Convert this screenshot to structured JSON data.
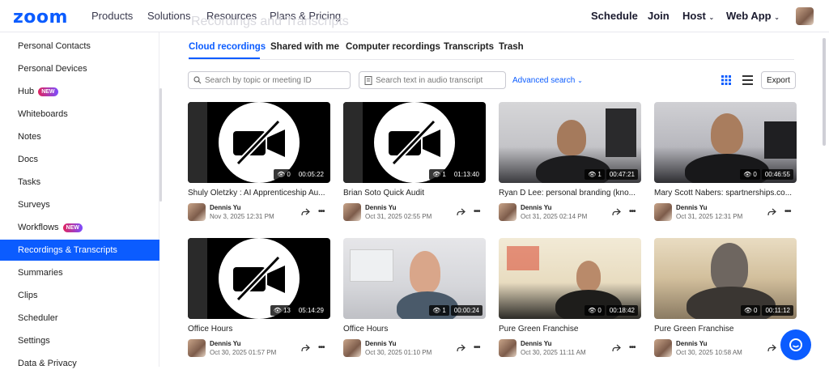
{
  "nav": {
    "logo": "zoom",
    "left_links": [
      "Products",
      "Solutions",
      "Resources",
      "Plans & Pricing"
    ],
    "right_links": [
      "Schedule",
      "Join",
      "Host",
      "Web App"
    ]
  },
  "sidebar": {
    "items": [
      {
        "label": "Personal Contacts"
      },
      {
        "label": "Personal Devices"
      },
      {
        "label": "Hub",
        "badge": "NEW"
      },
      {
        "label": "Whiteboards"
      },
      {
        "label": "Notes"
      },
      {
        "label": "Docs"
      },
      {
        "label": "Tasks"
      },
      {
        "label": "Surveys"
      },
      {
        "label": "Workflows",
        "badge": "NEW"
      },
      {
        "label": "Recordings & Transcripts",
        "active": true
      },
      {
        "label": "Summaries"
      },
      {
        "label": "Clips"
      },
      {
        "label": "Scheduler"
      },
      {
        "label": "Settings"
      },
      {
        "label": "Data & Privacy"
      }
    ]
  },
  "main": {
    "ghost_title": "Recordings and Transcripts",
    "tabs": [
      "Cloud recordings",
      "Shared with me",
      "Computer recordings",
      "Transcripts",
      "Trash"
    ],
    "search_placeholder": "Search by topic or meeting ID",
    "transcript_placeholder": "Search text in audio transcript",
    "advanced_search": "Advanced search",
    "export_label": "Export",
    "recordings": [
      {
        "title": "Shuly Oletzky : AI Apprenticeship Au...",
        "owner": "Dennis Yu",
        "date": "Nov 3, 2025 12:31 PM",
        "views": "0",
        "duration": "00:05:22",
        "type": "novideo"
      },
      {
        "title": "Brian Soto Quick Audit",
        "owner": "Dennis Yu",
        "date": "Oct 31, 2025 02:55 PM",
        "views": "1",
        "duration": "01:13:40",
        "type": "novideo"
      },
      {
        "title": "Ryan D Lee: personal branding (kno...",
        "owner": "Dennis Yu",
        "date": "Oct 31, 2025 02:14 PM",
        "views": "1",
        "duration": "00:47:21",
        "type": "camera"
      },
      {
        "title": "Mary Scott Nabers: spartnerships.co...",
        "owner": "Dennis Yu",
        "date": "Oct 31, 2025 12:31 PM",
        "views": "0",
        "duration": "00:46:55",
        "type": "camera"
      },
      {
        "title": "Office Hours",
        "owner": "Dennis Yu",
        "date": "Oct 30, 2025 01:57 PM",
        "views": "13",
        "duration": "05:14:29",
        "type": "novideo"
      },
      {
        "title": "Office Hours",
        "owner": "Dennis Yu",
        "date": "Oct 30, 2025 01:10 PM",
        "views": "1",
        "duration": "00:00:24",
        "type": "camera"
      },
      {
        "title": "Pure Green Franchise",
        "owner": "Dennis Yu",
        "date": "Oct 30, 2025 11:11 AM",
        "views": "0",
        "duration": "00:18:42",
        "type": "camera"
      },
      {
        "title": "Pure Green Franchise",
        "owner": "Dennis Yu",
        "date": "Oct 30, 2025 10:58 AM",
        "views": "0",
        "duration": "00:11:12",
        "type": "camera"
      }
    ]
  },
  "colors": {
    "accent": "#0b5cff"
  }
}
